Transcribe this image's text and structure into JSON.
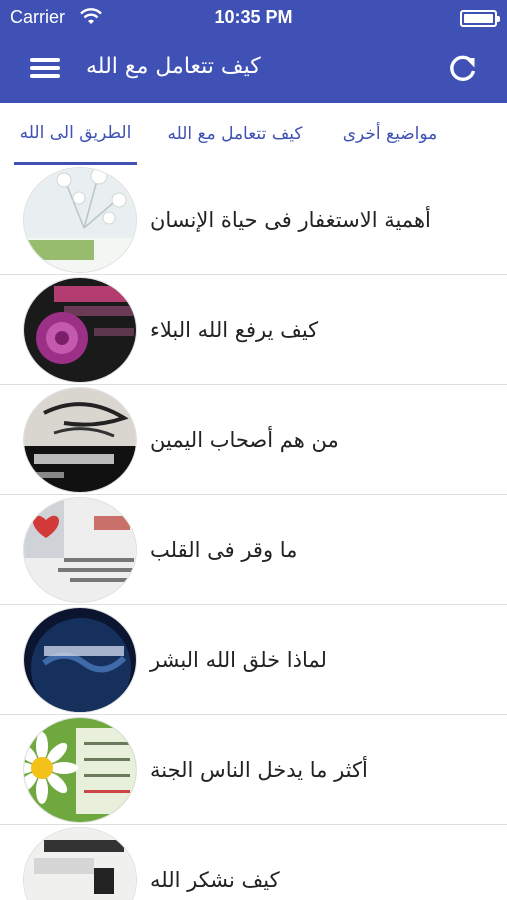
{
  "status_bar": {
    "carrier": "Carrier",
    "time": "10:35 PM"
  },
  "app_bar": {
    "title": "كيف تتعامل مع الله",
    "menu_icon": "hamburger-icon",
    "refresh_icon": "refresh-icon"
  },
  "tabs": [
    {
      "label": "مواضيع أخرى",
      "active": false
    },
    {
      "label": "كيف تتعامل مع الله",
      "active": false
    },
    {
      "label": "الطريق الى الله",
      "active": true
    }
  ],
  "list": {
    "items": [
      {
        "label": "أهمية الاستغفار فى حياة الإنسان",
        "thumb": "flowers-image"
      },
      {
        "label": "كيف يرفع الله البلاء",
        "thumb": "purple-rose-image"
      },
      {
        "label": "من هم أصحاب اليمين",
        "thumb": "calligraphy-image"
      },
      {
        "label": "ما وقر فى القلب",
        "thumb": "heart-image"
      },
      {
        "label": "لماذا خلق الله البشر",
        "thumb": "earth-image"
      },
      {
        "label": "أكثر ما يدخل الناس الجنة",
        "thumb": "daisy-image"
      },
      {
        "label": "كيف نشكر الله",
        "thumb": "text-image"
      }
    ]
  },
  "colors": {
    "primary": "#3f51b5",
    "divider": "#dedede"
  }
}
